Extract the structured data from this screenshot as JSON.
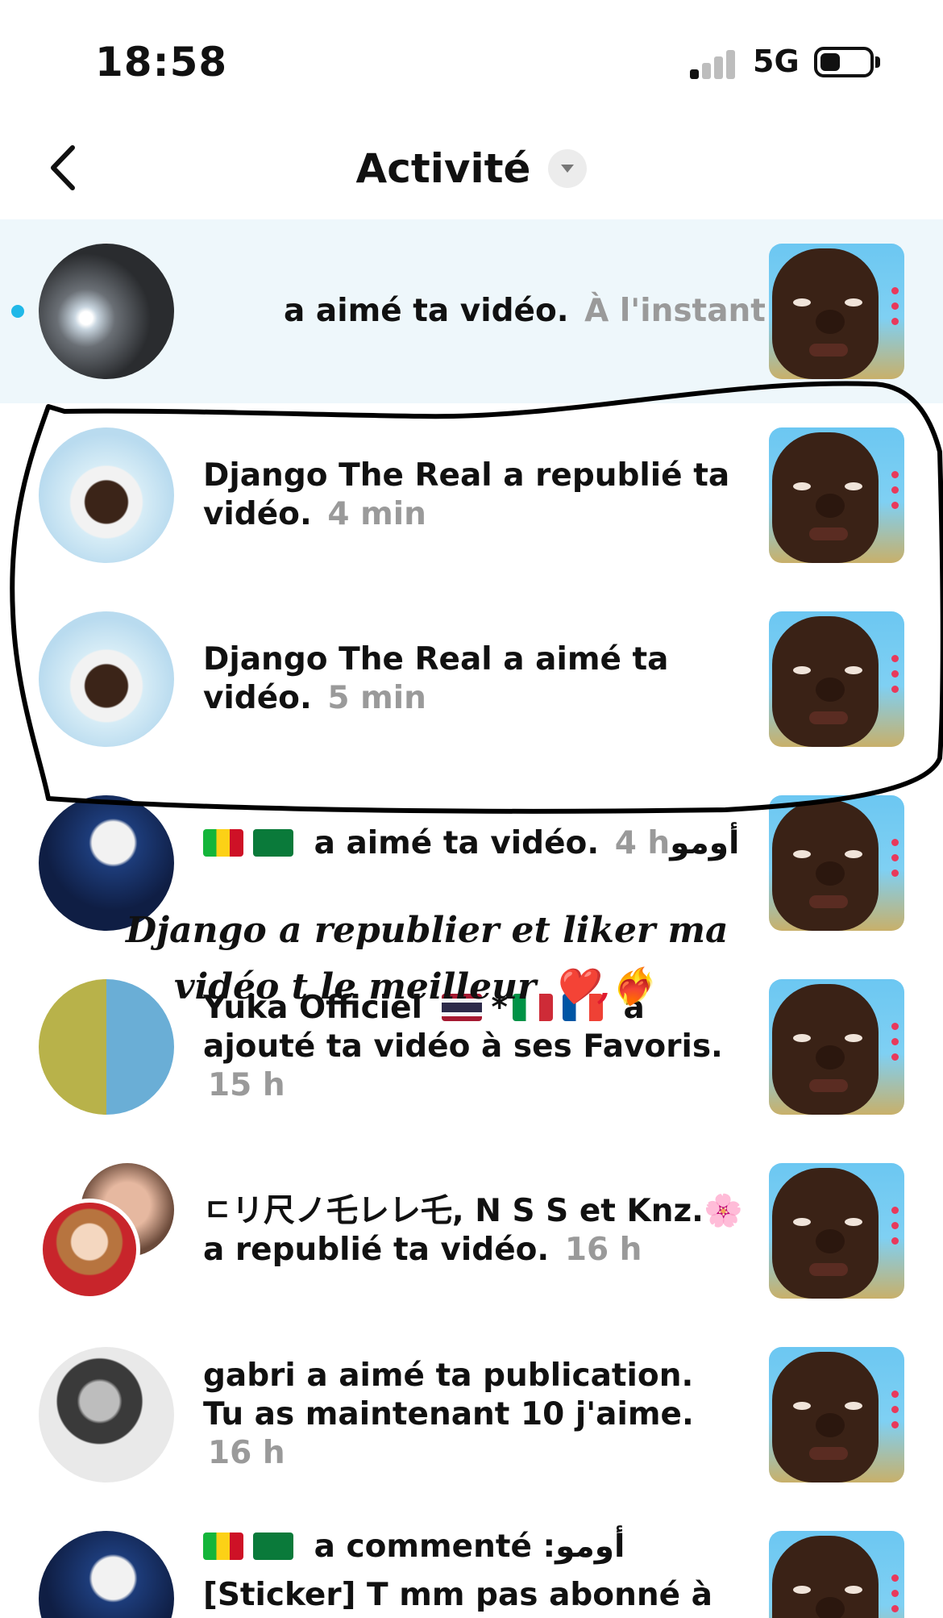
{
  "status_bar": {
    "time": "18:58",
    "network": "5G",
    "signal_bars_active": 1,
    "signal_bars_total": 4,
    "battery_level": 0.3
  },
  "header": {
    "title": "Activité",
    "back_icon": "chevron-left-icon",
    "dropdown_icon": "caret-down-icon"
  },
  "notifications": [
    {
      "text": "a aimé ta vidéo.",
      "time": "À l'instant",
      "unread": true
    },
    {
      "text": "Django The Real a republié ta vidéo.",
      "time": "4 min",
      "unread": false
    },
    {
      "text": "Django The Real a aimé ta vidéo.",
      "time": "5 min",
      "unread": false
    },
    {
      "text": "a aimé ta vidéo.",
      "time": "4 h",
      "suffix": "أومو",
      "unread": false
    },
    {
      "text_name": "Yuka Officiel",
      "text_flags_mid": "*",
      "text": "a ajouté ta vidéo à ses Favoris.",
      "time": "15 h",
      "unread": false
    },
    {
      "text": "ㄷリ尺ノ乇レレ乇, N S S et Knz.🌸 a republié ta vidéo.",
      "time": "16 h",
      "unread": false
    },
    {
      "text": "gabri a aimé ta publication. Tu as maintenant 10 j'aime.",
      "time": "16 h",
      "unread": false
    },
    {
      "text": "a commenté :أومو",
      "text_line2": "[Sticker] T mm pas abonné à lui",
      "unread": false
    }
  ],
  "annotation": {
    "line1": "Django a republier et liker ma",
    "line2": "vidéo t le meilleur",
    "emoji": "❤️,❤️‍🔥"
  },
  "colors": {
    "unread_bg": "#eef7fb",
    "unread_dot": "#20b8e8",
    "time_gray": "#9a9a9a"
  }
}
